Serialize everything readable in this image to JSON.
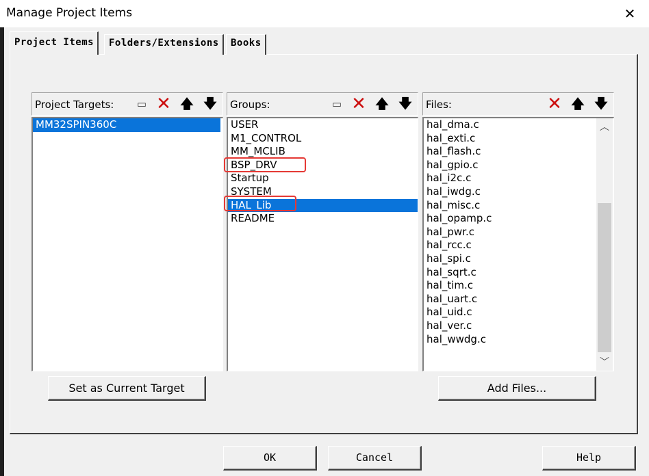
{
  "window": {
    "title": "Manage Project Items",
    "close_icon": "close-icon"
  },
  "tabs": [
    {
      "label": "Project Items",
      "active": true
    },
    {
      "label": "Folders/Extensions",
      "active": false
    },
    {
      "label": "Books",
      "active": false
    }
  ],
  "targets": {
    "label": "Project Targets:",
    "items": [
      "MM32SPIN360C"
    ],
    "selected": "MM32SPIN360C",
    "set_button": "Set as Current Target"
  },
  "groups": {
    "label": "Groups:",
    "items": [
      "USER",
      "M1_CONTROL",
      "MM_MCLIB",
      "BSP_DRV",
      "Startup",
      "SYSTEM",
      "HAL_Lib",
      "README"
    ],
    "selected": "HAL_Lib",
    "highlighted": [
      "BSP_DRV",
      "HAL_Lib"
    ],
    "highlight_color": "#e53935"
  },
  "files": {
    "label": "Files:",
    "items": [
      "hal_dma.c",
      "hal_exti.c",
      "hal_flash.c",
      "hal_gpio.c",
      "hal_i2c.c",
      "hal_iwdg.c",
      "hal_misc.c",
      "hal_opamp.c",
      "hal_pwr.c",
      "hal_rcc.c",
      "hal_spi.c",
      "hal_sqrt.c",
      "hal_tim.c",
      "hal_uart.c",
      "hal_uid.c",
      "hal_ver.c",
      "hal_wwdg.c"
    ],
    "add_button": "Add Files..."
  },
  "footer": {
    "ok": "OK",
    "cancel": "Cancel",
    "help": "Help"
  },
  "colors": {
    "selection": "#0a74da",
    "delete_icon": "#cc1010",
    "dialog_bg": "#f0f0f0"
  }
}
